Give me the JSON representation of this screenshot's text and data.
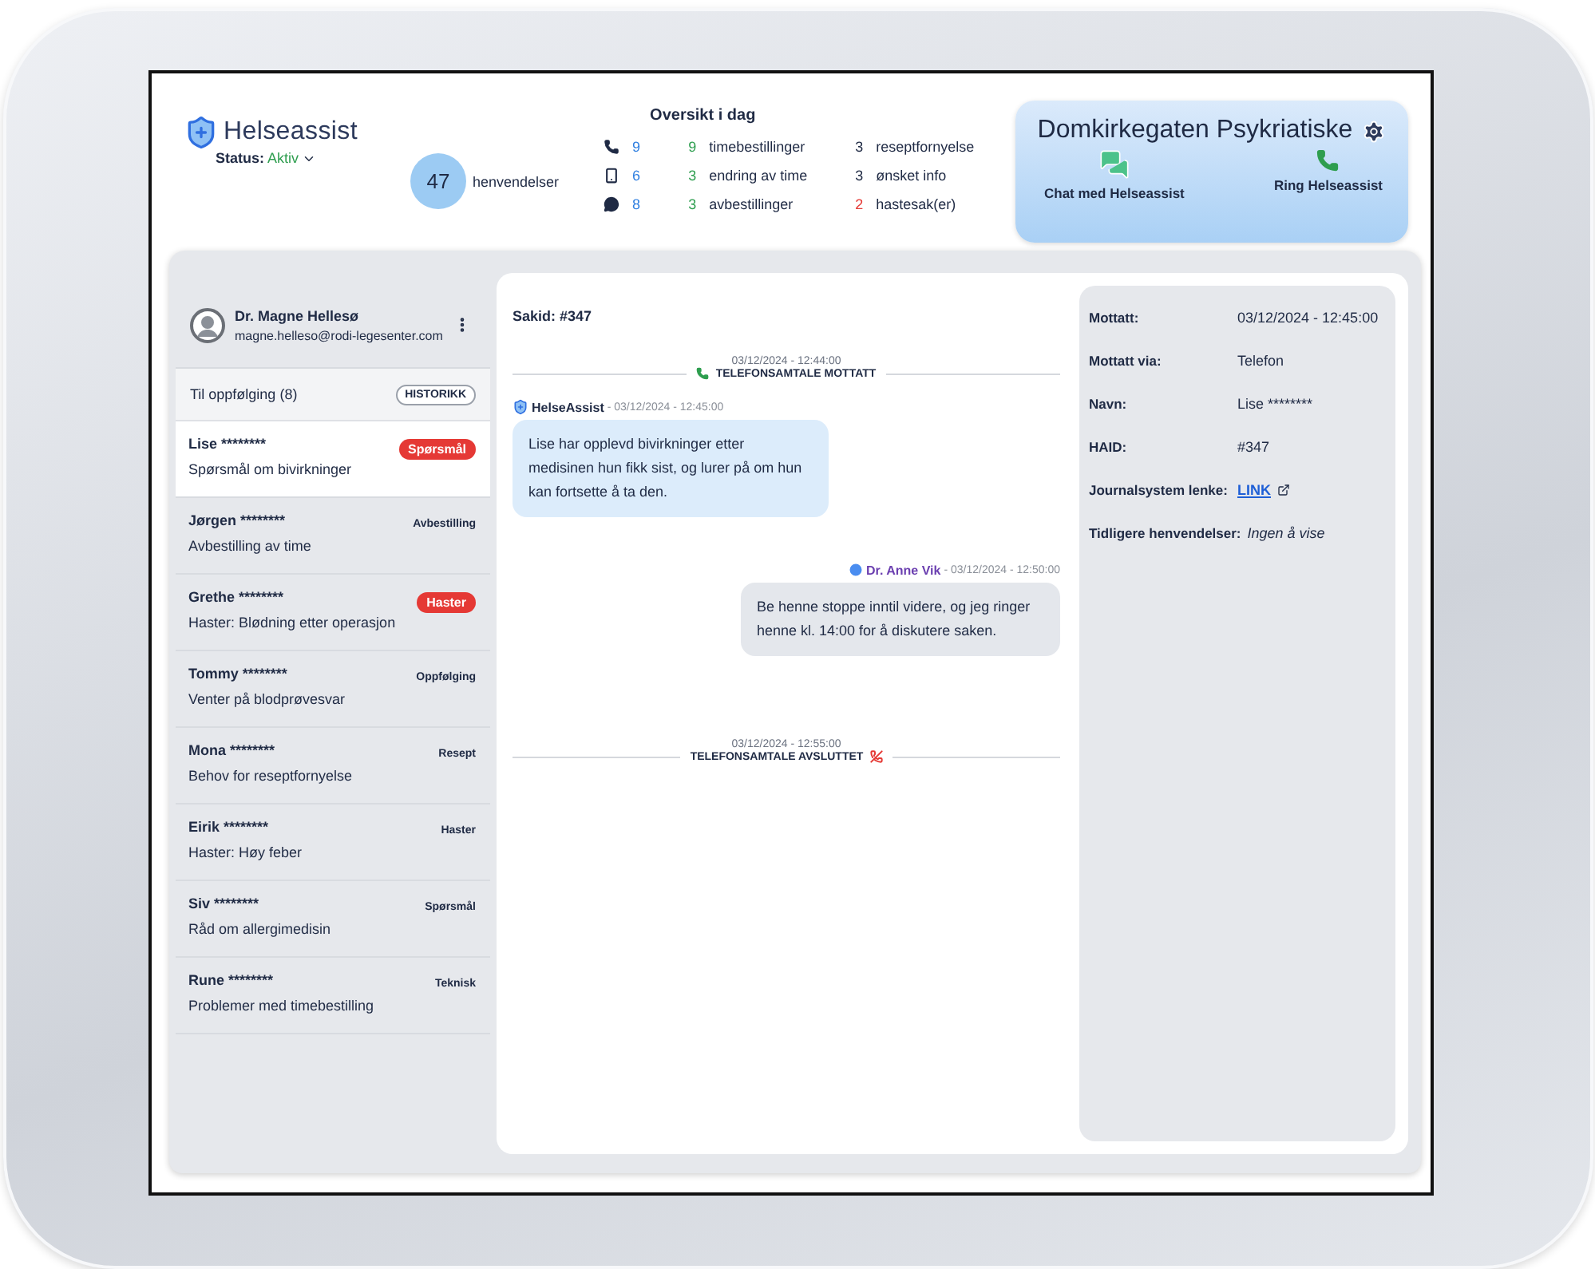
{
  "header": {
    "brand": "Helseassist",
    "status_label": "Status:",
    "status_value": "Aktiv",
    "total": {
      "count": "47",
      "label": "henvendelser"
    },
    "overview": {
      "title": "Oversikt i dag",
      "channels": [
        {
          "kind": "phone",
          "count": "9"
        },
        {
          "kind": "mobile",
          "count": "6"
        },
        {
          "kind": "chat",
          "count": "8"
        }
      ],
      "categories": [
        {
          "count": "9",
          "label": "timebestillinger",
          "color": "#2e9e4f"
        },
        {
          "count": "3",
          "label": "endring av time",
          "color": "#2e9e4f"
        },
        {
          "count": "3",
          "label": "avbestillinger",
          "color": "#2e9e4f"
        },
        {
          "count": "3",
          "label": "reseptfornyelse",
          "color": "#1f2a44"
        },
        {
          "count": "3",
          "label": "ønsket info",
          "color": "#1f2a44"
        },
        {
          "count": "2",
          "label": "hastesak(er)",
          "color": "#e53935"
        }
      ]
    },
    "clinic": {
      "name": "Domkirkegaten Psykriatiske",
      "actions": [
        {
          "kind": "chat",
          "label": "Chat med Helseassist"
        },
        {
          "kind": "call",
          "label": "Ring Helseassist"
        }
      ]
    }
  },
  "sidebar": {
    "user": {
      "name": "Dr. Magne Hellesø",
      "email": "magne.helleso@rodi-legesenter.com"
    },
    "section": "Til oppfølging (8)",
    "history_button": "HISTORIKK",
    "items": [
      {
        "name": "Lise ********",
        "subject": "Spørsmål om bivirkninger",
        "tag": "Spørsmål",
        "kind": "pill",
        "selected": true
      },
      {
        "name": "Jørgen ********",
        "subject": "Avbestilling av time",
        "tag": "Avbestilling",
        "kind": "plain",
        "selected": false
      },
      {
        "name": "Grethe ********",
        "subject": "Haster: Blødning etter operasjon",
        "tag": "Haster",
        "kind": "pill",
        "selected": false
      },
      {
        "name": "Tommy ********",
        "subject": "Venter på blodprøvesvar",
        "tag": "Oppfølging",
        "kind": "plain",
        "selected": false
      },
      {
        "name": "Mona ********",
        "subject": "Behov for reseptfornyelse",
        "tag": "Resept",
        "kind": "plain",
        "selected": false
      },
      {
        "name": "Eirik ********",
        "subject": "Haster: Høy feber",
        "tag": "Haster",
        "kind": "plain",
        "selected": false
      },
      {
        "name": "Siv ********",
        "subject": "Råd om allergimedisin",
        "tag": "Spørsmål",
        "kind": "plain",
        "selected": false
      },
      {
        "name": "Rune ********",
        "subject": "Problemer med timebestilling",
        "tag": "Teknisk",
        "kind": "plain",
        "selected": false
      }
    ]
  },
  "chat": {
    "case_id": "Sakid: #347",
    "entries": [
      {
        "kind": "call-start",
        "time": "03/12/2024 - 12:44:00",
        "label": "TELEFONSAMTALE MOTTATT"
      },
      {
        "kind": "incoming",
        "sender": "HelseAssist",
        "time": "- 03/12/2024 - 12:45:00",
        "text": "Lise har opplevd bivirkninger etter medisinen hun fikk sist, og lurer på om hun kan fortsette å ta den."
      },
      {
        "kind": "outgoing",
        "sender": "Dr. Anne Vik",
        "time": "- 03/12/2024 - 12:50:00",
        "text": "Be henne stoppe inntil videre, og jeg ringer henne kl. 14:00 for å diskutere saken."
      },
      {
        "kind": "call-end",
        "time": "03/12/2024 - 12:55:00",
        "label": "TELEFONSAMTALE AVSLUTTET"
      }
    ]
  },
  "details": [
    {
      "label": "Mottatt:",
      "value": "03/12/2024 - 12:45:00",
      "kind": "text"
    },
    {
      "label": "Mottatt via:",
      "value": "Telefon",
      "kind": "text"
    },
    {
      "label": "Navn:",
      "value": "Lise ********",
      "kind": "text"
    },
    {
      "label": "HAID:",
      "value": "#347",
      "kind": "text"
    },
    {
      "label": "Journalsystem lenke:",
      "value": "LINK",
      "kind": "link"
    },
    {
      "label": "Tidligere henvendelser:",
      "value": "Ingen å vise",
      "kind": "note"
    }
  ]
}
